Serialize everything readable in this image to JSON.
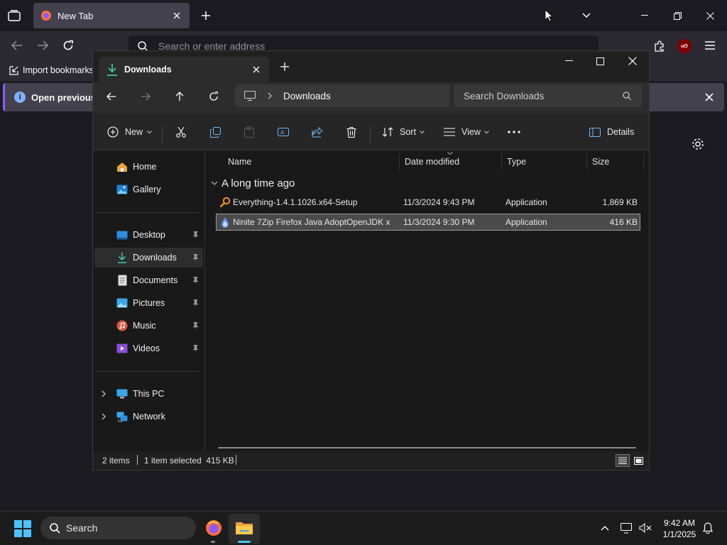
{
  "browser": {
    "tab_title": "New Tab",
    "address_placeholder": "Search or enter address",
    "import_bookmarks": "Import bookmarks",
    "infobar_text": "Open previous ta",
    "ublock_label": "uO",
    "accent": "#9059ff"
  },
  "explorer": {
    "tab_title": "Downloads",
    "breadcrumb": "Downloads",
    "search_placeholder": "Search Downloads",
    "commands": {
      "new": "New",
      "sort": "Sort",
      "view": "View",
      "details": "Details"
    },
    "sidebar": {
      "home": "Home",
      "gallery": "Gallery",
      "desktop": "Desktop",
      "downloads": "Downloads",
      "documents": "Documents",
      "pictures": "Pictures",
      "music": "Music",
      "videos": "Videos",
      "this_pc": "This PC",
      "network": "Network"
    },
    "columns": {
      "name": "Name",
      "date": "Date modified",
      "type": "Type",
      "size": "Size"
    },
    "group": "A long time ago",
    "files": [
      {
        "name": "Everything-1.4.1.1026.x64-Setup",
        "date": "11/3/2024 9:43 PM",
        "type": "Application",
        "size": "1,869 KB",
        "selected": false,
        "icon": "magnifier-icon"
      },
      {
        "name": "Ninite 7Zip Firefox Java AdoptOpenJDK x...",
        "date": "11/3/2024 9:30 PM",
        "type": "Application",
        "size": "416 KB",
        "selected": true,
        "icon": "ninite-icon"
      }
    ],
    "status": {
      "items": "2 items",
      "selected": "1 item selected  415 KB"
    }
  },
  "taskbar": {
    "search": "Search",
    "time": "9:42 AM",
    "date": "1/1/2025"
  }
}
